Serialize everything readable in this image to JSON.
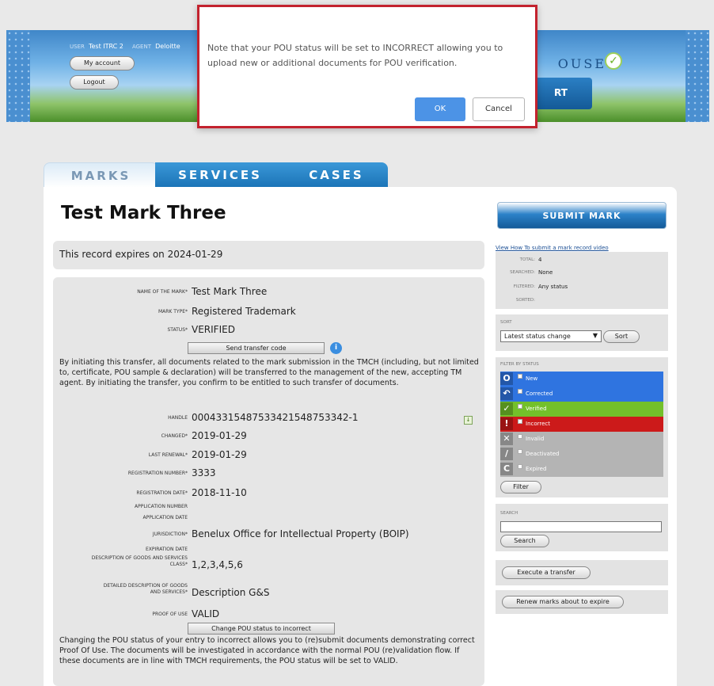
{
  "banner": {
    "user_label": "USER",
    "user_value": "Test ITRC 2",
    "agent_label": "AGENT",
    "agent_value": "Deloitte",
    "my_account": "My account",
    "logout": "Logout",
    "brand_text": "OUSE",
    "support_text": "RT"
  },
  "dialog": {
    "message": "Note that your POU status will be set to INCORRECT allowing you to upload new or additional documents for POU verification.",
    "ok": "OK",
    "cancel": "Cancel"
  },
  "tabs": [
    "MARKS",
    "SERVICES",
    "CASES"
  ],
  "title": "Test Mark Three",
  "expire_text": "This record expires on 2024-01-29",
  "fields": {
    "name_label": "NAME OF THE MARK*",
    "name_value": "Test Mark Three",
    "type_label": "MARK TYPE*",
    "type_value": "Registered Trademark",
    "status_label": "STATUS*",
    "status_value": "VERIFIED",
    "send_transfer": "Send transfer code",
    "transfer_text": "By initiating this transfer, all documents related to the mark submission in the TMCH (including, but not limited to, certificate, POU sample & declaration) will be transferred to the management of the new, accepting TM agent. By initiating the transfer, you confirm to be entitled to such transfer of documents.",
    "handle_label": "HANDLE",
    "handle_value": "00043315487533421548753342-1",
    "changed_label": "CHANGED*",
    "changed_value": "2019-01-29",
    "renewal_label": "LAST RENEWAL*",
    "renewal_value": "2019-01-29",
    "regnum_label": "REGISTRATION NUMBER*",
    "regnum_value": "3333",
    "regdate_label": "REGISTRATION DATE*",
    "regdate_value": "2018-11-10",
    "appnum_label": "APPLICATION NUMBER",
    "appdate_label": "APPLICATION DATE",
    "juris_label": "JURISDICTION*",
    "juris_value": "Benelux Office for Intellectual Property (BOIP)",
    "expdate_label": "EXPIRATION DATE",
    "class_label1": "DESCRIPTION OF GOODS AND SERVICES",
    "class_label2": "CLASS*",
    "class_value": "1,2,3,4,5,6",
    "detail_label1": "DETAILED DESCRIPTION OF GOODS",
    "detail_label2": "AND SERVICES*",
    "detail_value": "Description G&S",
    "pou_label": "PROOF OF USE",
    "pou_value": "VALID",
    "change_pou": "Change POU status to incorrect",
    "pou_text": "Changing the POU status of your entry to incorrect allows you to (re)submit documents demonstrating correct Proof Of Use. The documents will be investigated in accordance with the normal POU (re)validation flow. If these documents are in line with TMCH requirements, the POU status will be set to VALID."
  },
  "sidebar": {
    "submit": "SUBMIT MARK",
    "howto": "View How To submit a mark record video",
    "total_label": "TOTAL:",
    "total_value": "4",
    "searched_label": "SEARCHED:",
    "searched_value": "None",
    "filtered_label": "FILTERED:",
    "filtered_value": "Any status",
    "sorted_label": "SORTED:",
    "sort_header": "SORT",
    "sort_value": "Latest status change",
    "sort_button": "Sort",
    "filter_header": "FILTER BY STATUS",
    "filters": [
      {
        "label": "New",
        "color": "#2f74e0",
        "icon": "new-icon",
        "glyph": "O"
      },
      {
        "label": "Corrected",
        "color": "#2f74e0",
        "icon": "corrected-icon",
        "glyph": "↶"
      },
      {
        "label": "Verified",
        "color": "#73c02a",
        "icon": "verified-icon",
        "glyph": "✓"
      },
      {
        "label": "Incorrect",
        "color": "#cc1a1a",
        "icon": "incorrect-icon",
        "glyph": "!"
      },
      {
        "label": "Invalid",
        "color": "#b4b4b4",
        "icon": "invalid-icon",
        "glyph": "✕"
      },
      {
        "label": "Deactivated",
        "color": "#b4b4b4",
        "icon": "deactivated-icon",
        "glyph": "/"
      },
      {
        "label": "Expired",
        "color": "#b4b4b4",
        "icon": "expired-icon",
        "glyph": "C"
      }
    ],
    "filter_button": "Filter",
    "search_header": "SEARCH",
    "search_button": "Search",
    "transfer_button": "Execute a transfer",
    "renew_button": "Renew marks about to expire"
  }
}
